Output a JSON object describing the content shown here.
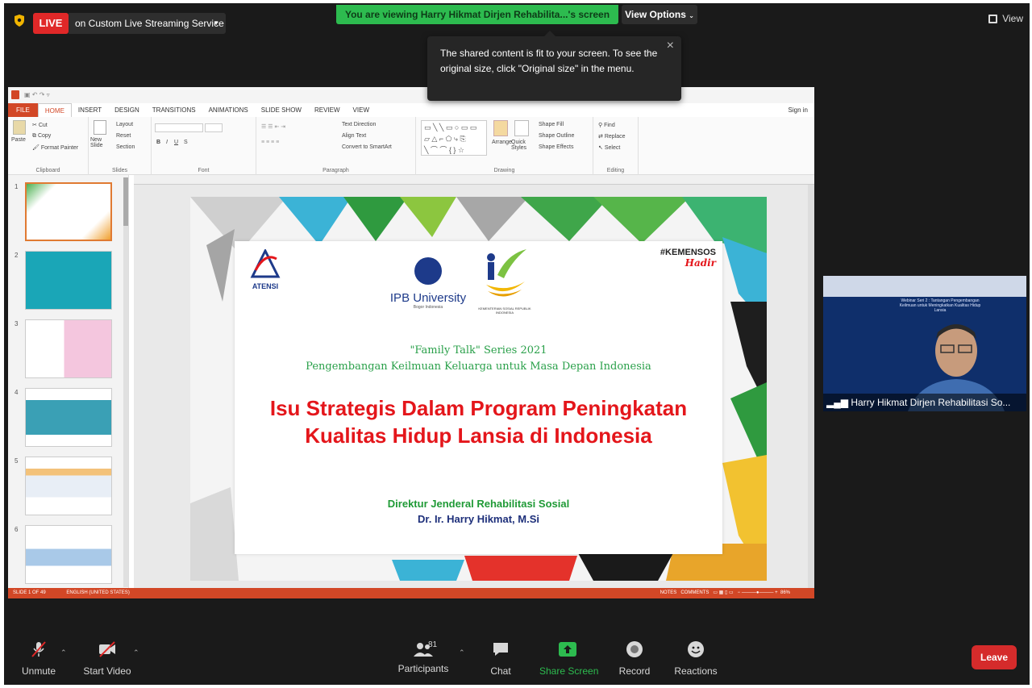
{
  "topbar": {
    "live_label": "LIVE",
    "live_target": "on Custom Live Streaming Service",
    "viewing_banner": "You are viewing Harry Hikmat Dirjen Rehabilita...'s screen",
    "view_options": "View Options",
    "view_label": "View"
  },
  "tooltip": {
    "text": "The shared content is fit to your screen. To see the original size, click \"Original size\" in the menu."
  },
  "ppt": {
    "tabs": [
      "FILE",
      "HOME",
      "INSERT",
      "DESIGN",
      "TRANSITIONS",
      "ANIMATIONS",
      "SLIDE SHOW",
      "REVIEW",
      "VIEW"
    ],
    "sign_in": "Sign in",
    "clipboard": {
      "paste": "Paste",
      "cut": "Cut",
      "copy": "Copy",
      "format_painter": "Format Painter",
      "label": "Clipboard"
    },
    "slides_group": {
      "new_slide": "New Slide",
      "layout": "Layout",
      "reset": "Reset",
      "section": "Section",
      "label": "Slides"
    },
    "font_label": "Font",
    "paragraph": {
      "text_direction": "Text Direction",
      "align_text": "Align Text",
      "smartart": "Convert to SmartArt",
      "label": "Paragraph"
    },
    "drawing": {
      "arrange": "Arrange",
      "quick_styles": "Quick Styles",
      "shape_fill": "Shape Fill",
      "shape_outline": "Shape Outline",
      "shape_effects": "Shape Effects",
      "label": "Drawing"
    },
    "editing": {
      "find": "Find",
      "replace": "Replace",
      "select": "Select",
      "label": "Editing"
    },
    "thumb_numbers": [
      "1",
      "2",
      "3",
      "4",
      "5",
      "6"
    ],
    "status_left": "SLIDE 1 OF 49",
    "status_lang": "ENGLISH (UNITED STATES)",
    "status_notes": "NOTES",
    "status_comments": "COMMENTS",
    "zoom": "86%"
  },
  "slide": {
    "logo_atensi": "ATENSI",
    "logo_ipb": "IPB University",
    "logo_ipb_sub": "Bogor Indonesia",
    "logo_kemensos": "KEMENTERIAN SOSIAL REPUBLIK INDONESIA",
    "hashtag": "#KEMENSOS",
    "hashtag_script": "Hadir",
    "series": "\"Family Talk\" Series 2021",
    "subtitle": "Pengembangan Keilmuan Keluarga untuk Masa Depan Indonesia",
    "title_line1": "Isu Strategis Dalam Program Peningkatan",
    "title_line2": "Kualitas Hidup Lansia di Indonesia",
    "director": "Direktur Jenderal Rehabilitasi Sosial",
    "name": "Dr. Ir. Harry Hikmat, M.Si"
  },
  "video": {
    "name": "Harry Hikmat Dirjen Rehabilitasi So...",
    "webinar_text": "Webinar Seri 2 : Tantangan Pengembangan Keilmuan untuk Meningkatkan Kualitas Hidup Lansia"
  },
  "toolbar": {
    "unmute": "Unmute",
    "start_video": "Start Video",
    "participants": "Participants",
    "participants_count": "81",
    "chat": "Chat",
    "share_screen": "Share Screen",
    "record": "Record",
    "reactions": "Reactions",
    "leave": "Leave"
  },
  "colors": {
    "live_red": "#e02828",
    "share_green": "#2dbb4f",
    "ppt_orange": "#d24726",
    "leave_red": "#d52b2b",
    "title_red": "#e4161b",
    "series_green": "#2aa04a"
  }
}
